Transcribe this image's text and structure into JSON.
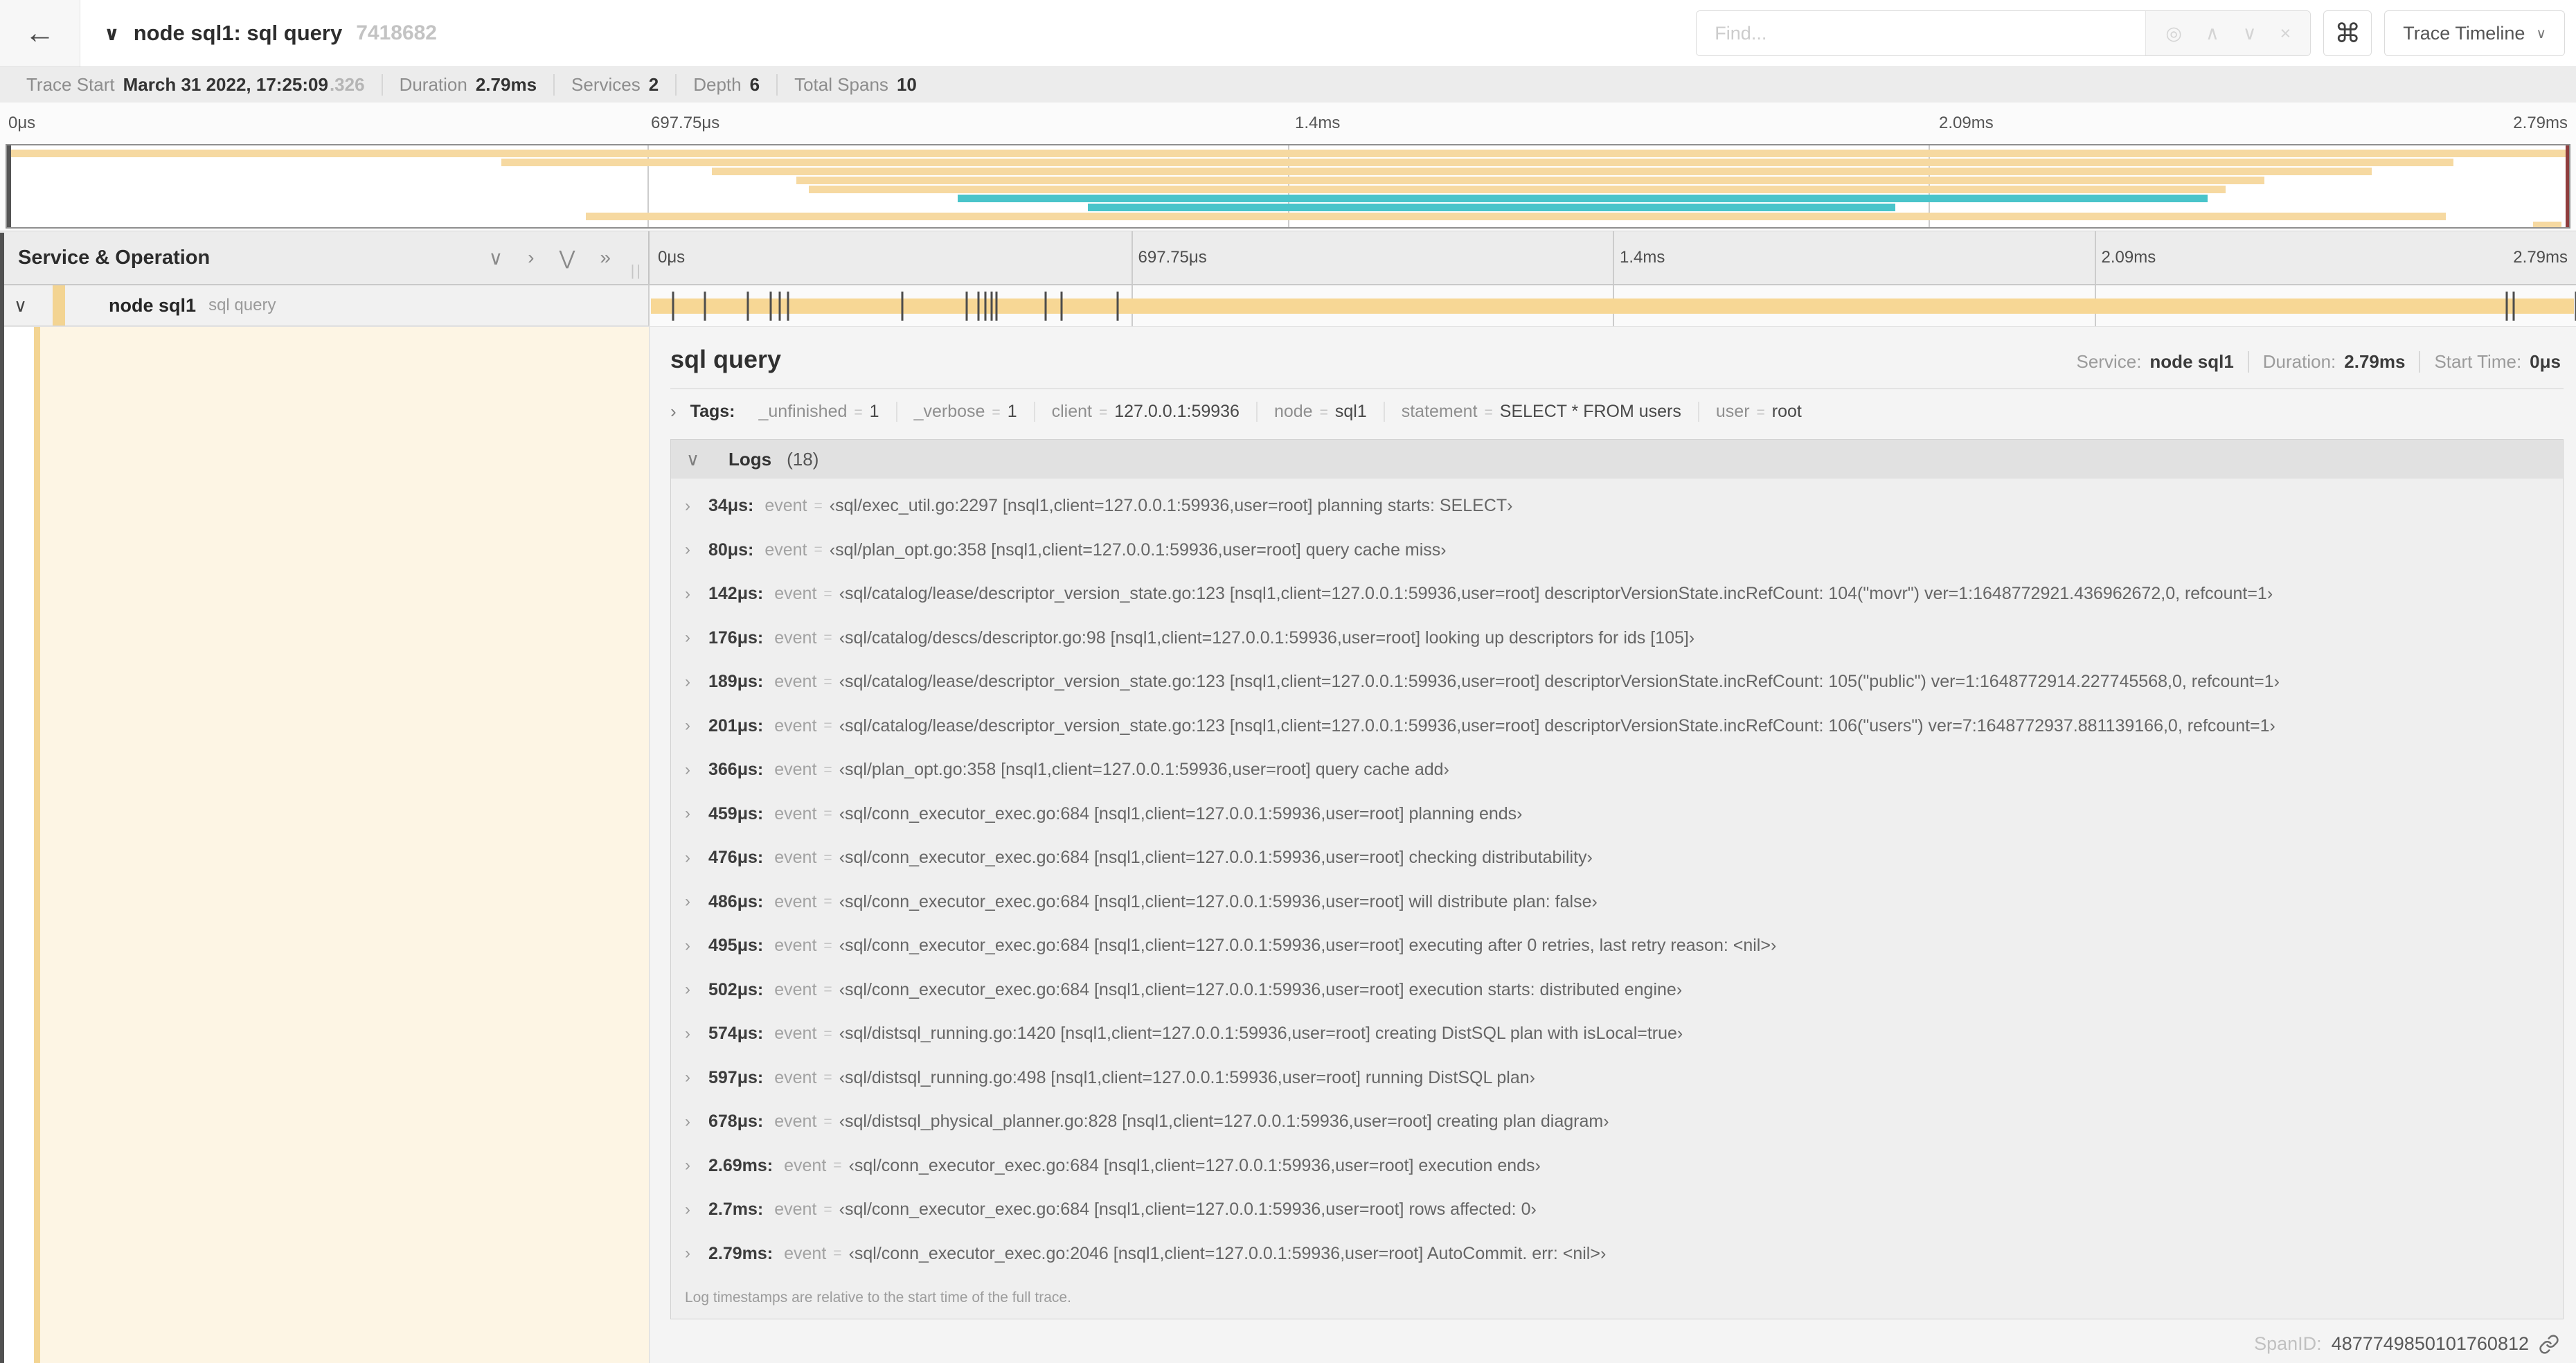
{
  "header": {
    "back_icon": "←",
    "collapse_icon": "∨",
    "title": "node sql1: sql query",
    "trace_id_short": "7418682",
    "find_placeholder": "Find...",
    "locate_icon": "◎",
    "prev_icon": "∧",
    "next_icon": "∨",
    "clear_icon": "×",
    "shortcut_icon": "⌘",
    "view_selector": "Trace Timeline",
    "view_caret": "∨"
  },
  "summary": {
    "items": [
      {
        "label": "Trace Start",
        "value": "March 31 2022, 17:25:09",
        "suffix": ".326"
      },
      {
        "label": "Duration",
        "value": "2.79ms"
      },
      {
        "label": "Services",
        "value": "2"
      },
      {
        "label": "Depth",
        "value": "6"
      },
      {
        "label": "Total Spans",
        "value": "10"
      }
    ]
  },
  "timeline": {
    "duration_us": 2790,
    "ticks": [
      {
        "label": "0μs",
        "at": 0
      },
      {
        "label": "697.75μs",
        "at": 25
      },
      {
        "label": "1.4ms",
        "at": 50
      },
      {
        "label": "2.09ms",
        "at": 75
      },
      {
        "label": "2.79ms",
        "at": 100
      }
    ],
    "minimap_spans": [
      {
        "start": 0.0,
        "end": 1.0,
        "color": "tan"
      },
      {
        "start": 0.193,
        "end": 0.955,
        "color": "tan"
      },
      {
        "start": 0.275,
        "end": 0.923,
        "color": "tan"
      },
      {
        "start": 0.308,
        "end": 0.881,
        "color": "tan"
      },
      {
        "start": 0.313,
        "end": 0.866,
        "color": "tan"
      },
      {
        "start": 0.371,
        "end": 0.859,
        "color": "teal"
      },
      {
        "start": 0.422,
        "end": 0.737,
        "color": "teal"
      },
      {
        "start": 0.226,
        "end": 0.952,
        "color": "tan"
      },
      {
        "start": 0.986,
        "end": 0.997,
        "color": "tan"
      }
    ],
    "colors": {
      "tan": "#f6d9a1",
      "teal": "#49c4ca"
    }
  },
  "span_list_header": {
    "title": "Service & Operation",
    "collapse_one_icon": "∨",
    "collapse_all_icon": "›",
    "expand_one_icon": "⋁",
    "expand_all_icon": "»",
    "grip": "||"
  },
  "span_row": {
    "chevron": "∨",
    "service": "node sql1",
    "operation": "sql query",
    "log_marker_times_us": [
      34,
      80,
      142,
      176,
      189,
      201,
      366,
      459,
      476,
      486,
      495,
      502,
      574,
      597,
      678,
      2690,
      2700,
      2790
    ]
  },
  "detail": {
    "title": "sql query",
    "meta": [
      {
        "label": "Service:",
        "value": "node sql1"
      },
      {
        "label": "Duration:",
        "value": "2.79ms"
      },
      {
        "label": "Start Time:",
        "value": "0μs"
      }
    ],
    "acc_chevron_right": "›",
    "acc_chevron_down": "∨",
    "eq": "=",
    "tags_label": "Tags:",
    "tags": [
      {
        "key": "_unfinished",
        "value": "1"
      },
      {
        "key": "_verbose",
        "value": "1"
      },
      {
        "key": "client",
        "value": "127.0.0.1:59936"
      },
      {
        "key": "node",
        "value": "sql1"
      },
      {
        "key": "statement",
        "value": "SELECT * FROM users"
      },
      {
        "key": "user",
        "value": "root"
      }
    ],
    "logs_label": "Logs",
    "logs_count": "(18)",
    "log_field": "event",
    "logs": [
      {
        "time": "34μs:",
        "msg": "‹sql/exec_util.go:2297 [nsql1,client=127.0.0.1:59936,user=root] planning starts: SELECT›"
      },
      {
        "time": "80μs:",
        "msg": "‹sql/plan_opt.go:358 [nsql1,client=127.0.0.1:59936,user=root] query cache miss›"
      },
      {
        "time": "142μs:",
        "msg": "‹sql/catalog/lease/descriptor_version_state.go:123 [nsql1,client=127.0.0.1:59936,user=root] descriptorVersionState.incRefCount: 104(\"movr\") ver=1:1648772921.436962672,0, refcount=1›"
      },
      {
        "time": "176μs:",
        "msg": "‹sql/catalog/descs/descriptor.go:98 [nsql1,client=127.0.0.1:59936,user=root] looking up descriptors for ids [105]›"
      },
      {
        "time": "189μs:",
        "msg": "‹sql/catalog/lease/descriptor_version_state.go:123 [nsql1,client=127.0.0.1:59936,user=root] descriptorVersionState.incRefCount: 105(\"public\") ver=1:1648772914.227745568,0, refcount=1›"
      },
      {
        "time": "201μs:",
        "msg": "‹sql/catalog/lease/descriptor_version_state.go:123 [nsql1,client=127.0.0.1:59936,user=root] descriptorVersionState.incRefCount: 106(\"users\") ver=7:1648772937.881139166,0, refcount=1›"
      },
      {
        "time": "366μs:",
        "msg": "‹sql/plan_opt.go:358 [nsql1,client=127.0.0.1:59936,user=root] query cache add›"
      },
      {
        "time": "459μs:",
        "msg": "‹sql/conn_executor_exec.go:684 [nsql1,client=127.0.0.1:59936,user=root] planning ends›"
      },
      {
        "time": "476μs:",
        "msg": "‹sql/conn_executor_exec.go:684 [nsql1,client=127.0.0.1:59936,user=root] checking distributability›"
      },
      {
        "time": "486μs:",
        "msg": "‹sql/conn_executor_exec.go:684 [nsql1,client=127.0.0.1:59936,user=root] will distribute plan: false›"
      },
      {
        "time": "495μs:",
        "msg": "‹sql/conn_executor_exec.go:684 [nsql1,client=127.0.0.1:59936,user=root] executing after 0 retries, last retry reason: <nil>›"
      },
      {
        "time": "502μs:",
        "msg": "‹sql/conn_executor_exec.go:684 [nsql1,client=127.0.0.1:59936,user=root] execution starts: distributed engine›"
      },
      {
        "time": "574μs:",
        "msg": "‹sql/distsql_running.go:1420 [nsql1,client=127.0.0.1:59936,user=root] creating DistSQL plan with isLocal=true›"
      },
      {
        "time": "597μs:",
        "msg": "‹sql/distsql_running.go:498 [nsql1,client=127.0.0.1:59936,user=root] running DistSQL plan›"
      },
      {
        "time": "678μs:",
        "msg": "‹sql/distsql_physical_planner.go:828 [nsql1,client=127.0.0.1:59936,user=root] creating plan diagram›"
      },
      {
        "time": "2.69ms:",
        "msg": "‹sql/conn_executor_exec.go:684 [nsql1,client=127.0.0.1:59936,user=root] execution ends›"
      },
      {
        "time": "2.7ms:",
        "msg": "‹sql/conn_executor_exec.go:684 [nsql1,client=127.0.0.1:59936,user=root] rows affected: 0›"
      },
      {
        "time": "2.79ms:",
        "msg": "‹sql/conn_executor_exec.go:2046 [nsql1,client=127.0.0.1:59936,user=root] AutoCommit. err: <nil>›"
      }
    ],
    "footer_note": "Log timestamps are relative to the start time of the full trace.",
    "span_id_label": "SpanID:",
    "span_id": "4877749850101760812"
  }
}
